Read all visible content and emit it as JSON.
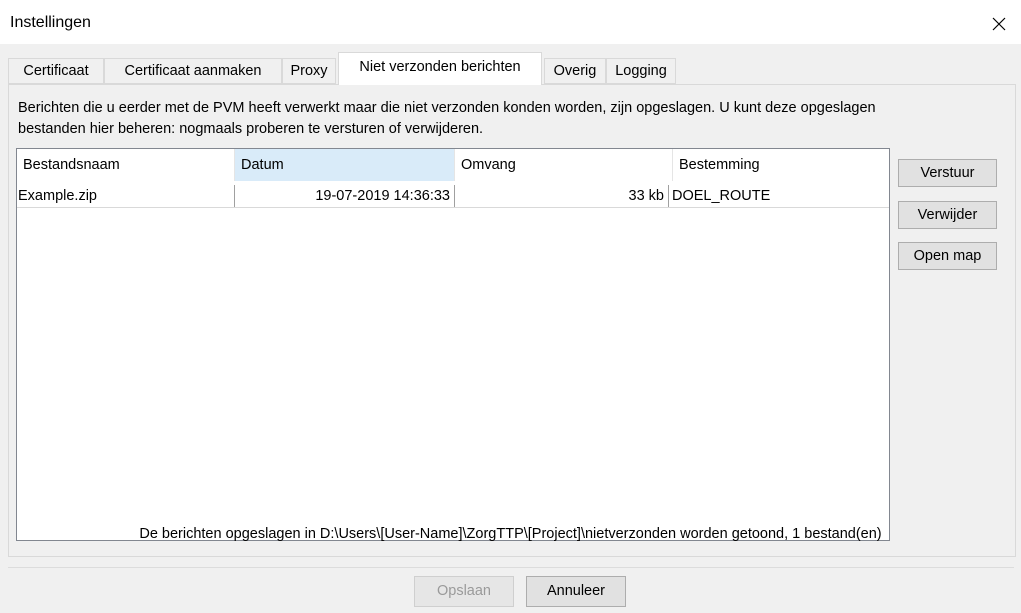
{
  "window": {
    "title": "Instellingen"
  },
  "tabs": [
    {
      "label": "Certificaat"
    },
    {
      "label": "Certificaat aanmaken"
    },
    {
      "label": "Proxy"
    },
    {
      "label": "Niet verzonden berichten",
      "active": true
    },
    {
      "label": "Overig"
    },
    {
      "label": "Logging"
    }
  ],
  "description": "Berichten die u eerder met de PVM heeft verwerkt maar die niet verzonden konden worden, zijn opgeslagen. U kunt deze opgeslagen bestanden hier beheren: nogmaals proberen te versturen of verwijderen.",
  "table": {
    "columns": [
      "Bestandsnaam",
      "Datum",
      "Omvang",
      "Bestemming"
    ],
    "sorted_column": "Datum",
    "rows": [
      {
        "bestandsnaam": "Example.zip",
        "datum": "19-07-2019 14:36:33",
        "omvang": "33 kb",
        "bestemming": "DOEL_ROUTE"
      }
    ]
  },
  "actions": {
    "send": "Verstuur",
    "delete": "Verwijder",
    "open_folder": "Open map"
  },
  "status": "De berichten opgeslagen in D:\\Users\\[User-Name]\\ZorgTTP\\[Project]\\nietverzonden worden getoond, 1 bestand(en)",
  "footer": {
    "save": "Opslaan",
    "save_disabled": true,
    "cancel": "Annuleer"
  },
  "icons": {
    "close": "close-icon"
  },
  "colors": {
    "sorted_header": "#d9ebf9",
    "dialog_bg": "#f0f0f0"
  }
}
